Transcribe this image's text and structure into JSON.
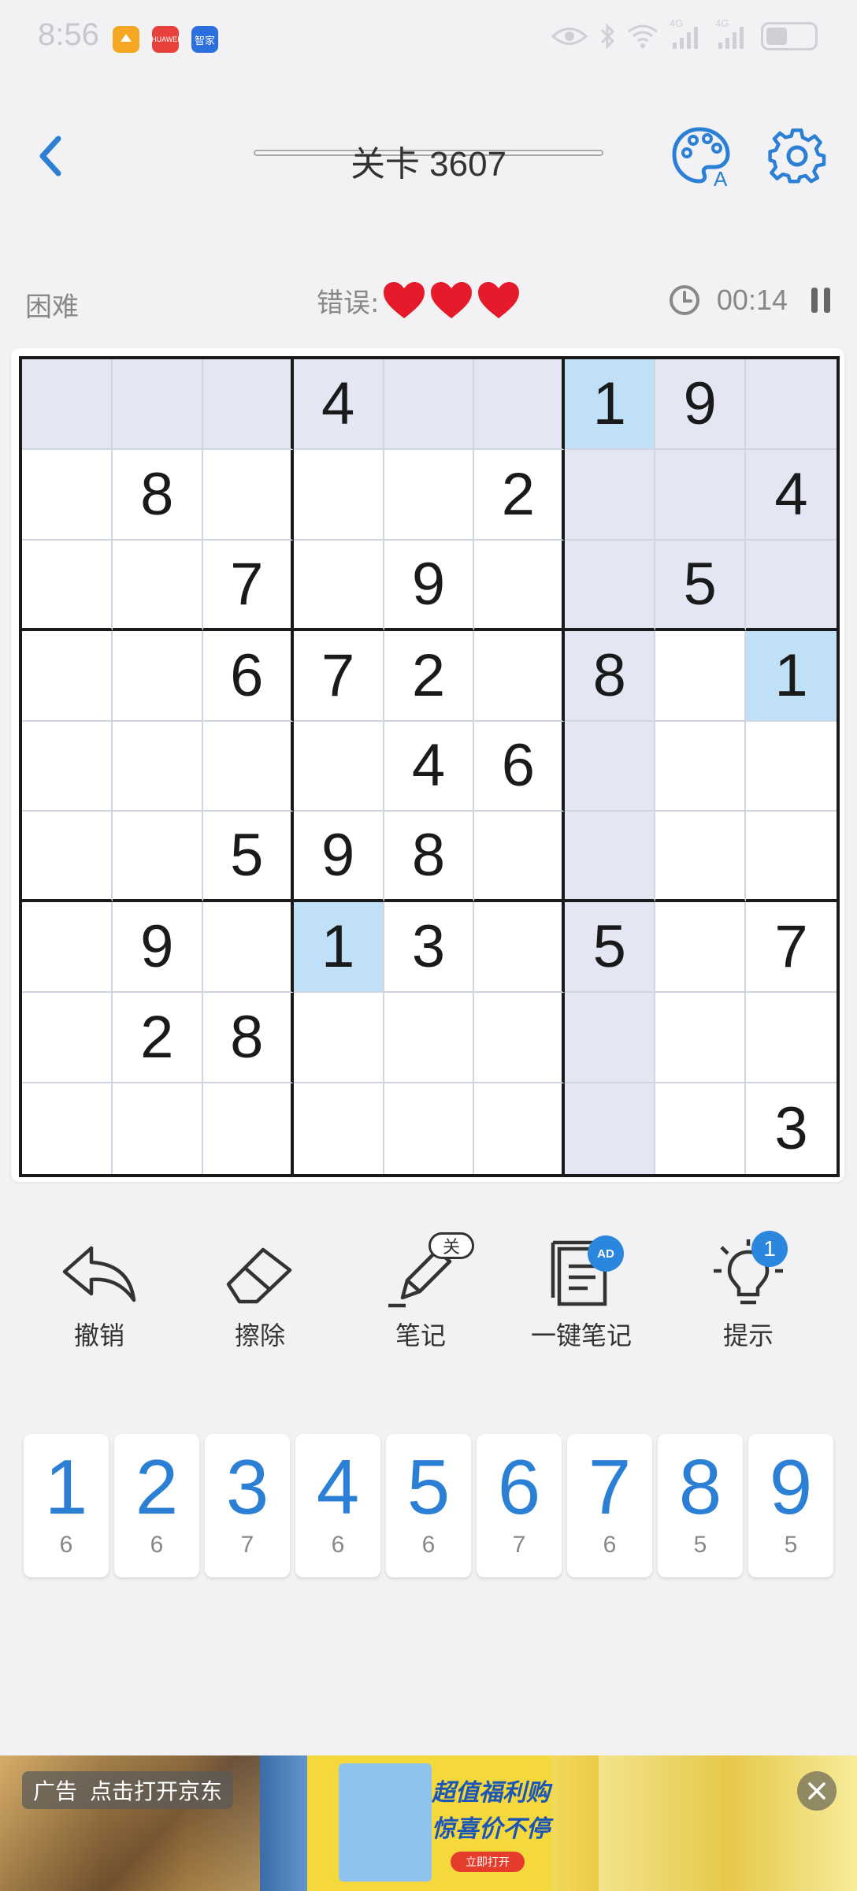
{
  "status_bar": {
    "time": "8:56",
    "apps": [
      {
        "name": "app-icon-orange",
        "color": "#f5a623",
        "text": ""
      },
      {
        "name": "app-icon-huawei",
        "color": "#e8413c",
        "text": "HUAWEI"
      },
      {
        "name": "app-icon-blue",
        "color": "#2a6fdb",
        "text": "智家"
      }
    ],
    "signal_labels": [
      "4G",
      "4G"
    ]
  },
  "header": {
    "title": "关卡 3607"
  },
  "info": {
    "difficulty": "困难",
    "errors_label": "错误:",
    "hearts": 3,
    "timer": "00:14"
  },
  "board": {
    "cells": [
      [
        "",
        "",
        "",
        "4",
        "",
        "",
        "1",
        "9",
        ""
      ],
      [
        "",
        "8",
        "",
        "",
        "",
        "2",
        "",
        "",
        "4"
      ],
      [
        "",
        "",
        "7",
        "",
        "9",
        "",
        "",
        "5",
        ""
      ],
      [
        "",
        "",
        "6",
        "7",
        "2",
        "",
        "8",
        "",
        "1"
      ],
      [
        "",
        "",
        "",
        "",
        "4",
        "6",
        "",
        "",
        ""
      ],
      [
        "",
        "",
        "5",
        "9",
        "8",
        "",
        "",
        "",
        ""
      ],
      [
        "",
        "9",
        "",
        "1",
        "3",
        "",
        "5",
        "",
        "7"
      ],
      [
        "",
        "2",
        "8",
        "",
        "",
        "",
        "",
        "",
        ""
      ],
      [
        "",
        "",
        "",
        "",
        "",
        "",
        "",
        "",
        "3"
      ]
    ],
    "selected": {
      "row": 0,
      "col": 6
    },
    "colors": {
      "highlight": "#e4e6f4",
      "same_number": "#bfe0f6"
    }
  },
  "toolbar": {
    "tools": [
      {
        "id": "undo",
        "label": "撤销"
      },
      {
        "id": "erase",
        "label": "擦除"
      },
      {
        "id": "notes",
        "label": "笔记",
        "badge": "关"
      },
      {
        "id": "auto-notes",
        "label": "一键笔记",
        "badge": "AD"
      },
      {
        "id": "hint",
        "label": "提示",
        "badge": "1"
      }
    ]
  },
  "numpad": {
    "keys": [
      {
        "digit": "1",
        "count": "6"
      },
      {
        "digit": "2",
        "count": "6"
      },
      {
        "digit": "3",
        "count": "7"
      },
      {
        "digit": "4",
        "count": "6"
      },
      {
        "digit": "5",
        "count": "6"
      },
      {
        "digit": "6",
        "count": "7"
      },
      {
        "digit": "7",
        "count": "6"
      },
      {
        "digit": "8",
        "count": "5"
      },
      {
        "digit": "9",
        "count": "5"
      }
    ]
  },
  "ad": {
    "tag": "广告",
    "action": "点击打开京东",
    "slogan_line1": "超值福利购",
    "slogan_line2": "惊喜价不停",
    "cta": "立即打开"
  }
}
